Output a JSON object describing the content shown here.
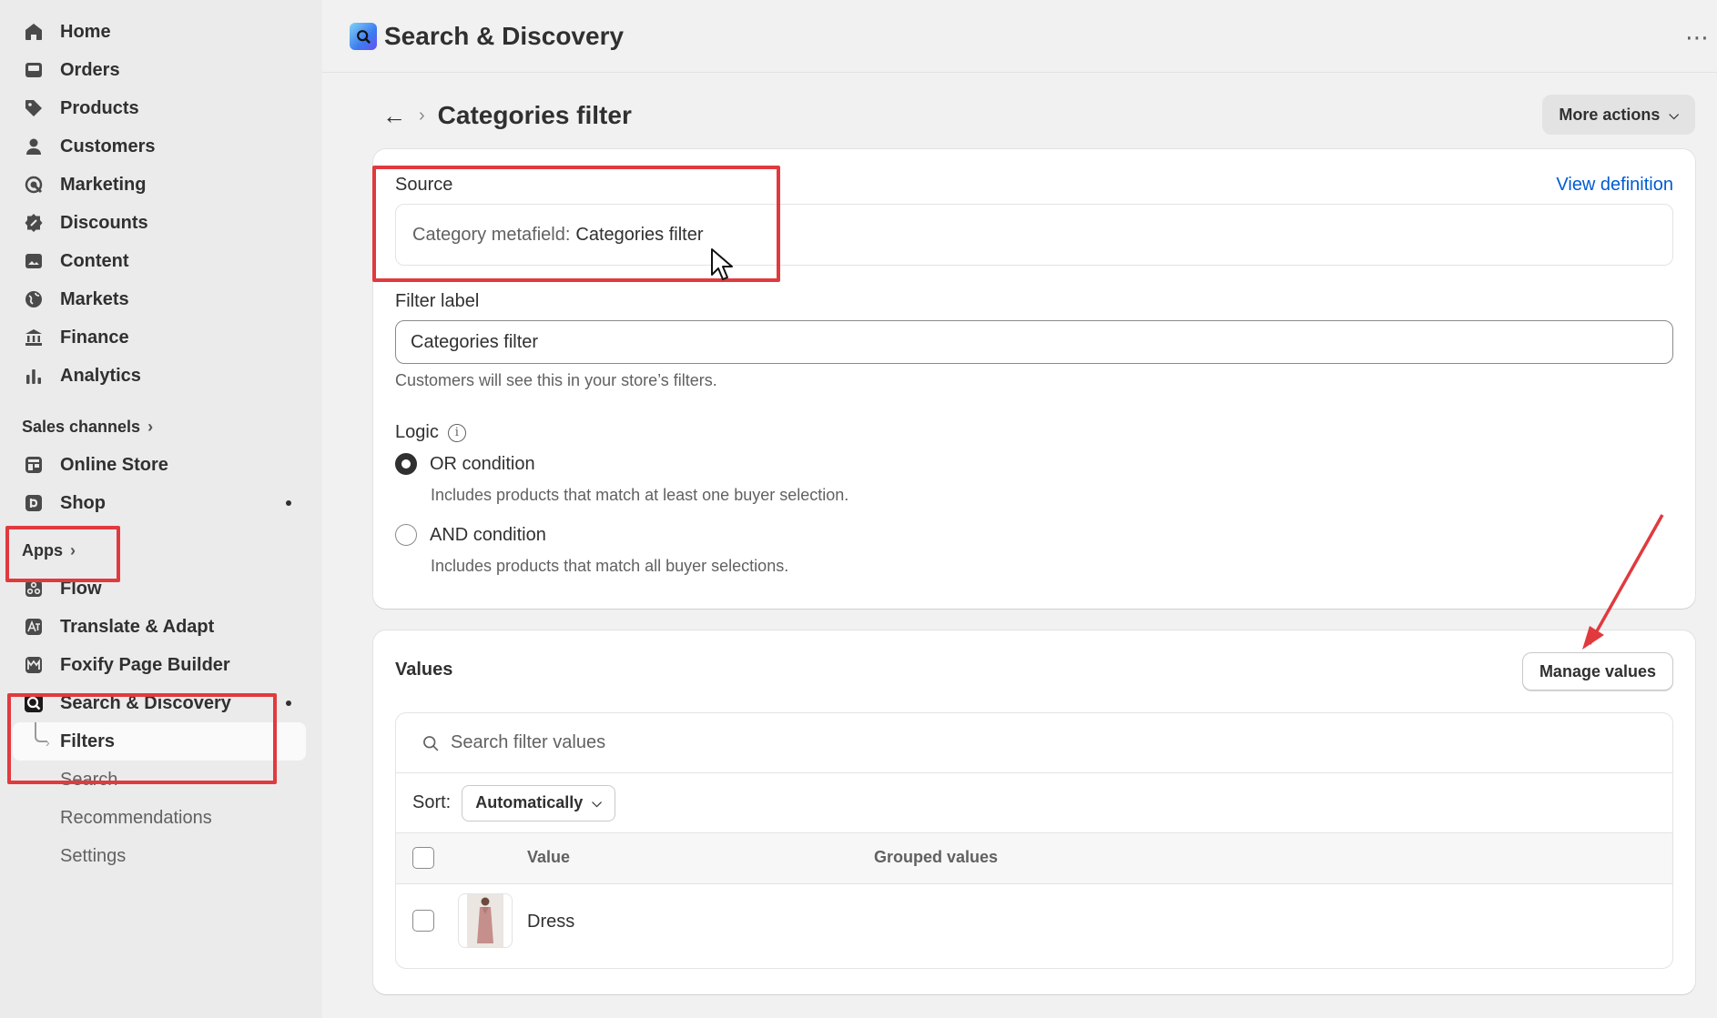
{
  "sidebar": {
    "main_items": [
      {
        "label": "Home",
        "icon": "home-icon"
      },
      {
        "label": "Orders",
        "icon": "inbox-icon"
      },
      {
        "label": "Products",
        "icon": "tag-icon"
      },
      {
        "label": "Customers",
        "icon": "person-icon"
      },
      {
        "label": "Marketing",
        "icon": "target-icon"
      },
      {
        "label": "Discounts",
        "icon": "discount-icon"
      },
      {
        "label": "Content",
        "icon": "image-icon"
      },
      {
        "label": "Markets",
        "icon": "globe-icon"
      },
      {
        "label": "Finance",
        "icon": "bank-icon"
      },
      {
        "label": "Analytics",
        "icon": "bar-chart-icon"
      }
    ],
    "sales_channels_label": "Sales channels",
    "sales_channels": [
      {
        "label": "Online Store",
        "icon": "store-icon"
      },
      {
        "label": "Shop",
        "icon": "shop-icon"
      }
    ],
    "apps_label": "Apps",
    "apps": [
      {
        "label": "Flow",
        "icon": "flow-icon"
      },
      {
        "label": "Translate & Adapt",
        "icon": "translate-icon"
      },
      {
        "label": "Foxify Page Builder",
        "icon": "foxify-icon"
      },
      {
        "label": "Search & Discovery",
        "icon": "search-discovery-icon"
      }
    ],
    "sub_items": [
      "Filters",
      "Search",
      "Recommendations",
      "Settings"
    ]
  },
  "topbar": {
    "app_title": "Search & Discovery",
    "more_icon": "ellipsis-icon"
  },
  "page": {
    "title": "Categories filter",
    "more_actions": "More actions"
  },
  "source_card": {
    "source_label": "Source",
    "view_definition": "View definition",
    "source_prefix": "Category metafield:",
    "source_value": "Categories filter",
    "filter_label": "Filter label",
    "filter_value": "Categories filter",
    "filter_help": "Customers will see this in your store’s filters.",
    "logic_label": "Logic",
    "or_label": "OR condition",
    "or_desc": "Includes products that match at least one buyer selection.",
    "and_label": "AND condition",
    "and_desc": "Includes products that match all buyer selections.",
    "selected": "OR"
  },
  "values_card": {
    "title": "Values",
    "manage_button": "Manage values",
    "search_placeholder": "Search filter values",
    "sort_label": "Sort:",
    "sort_value": "Automatically",
    "columns": [
      "Value",
      "Grouped values"
    ],
    "rows": [
      {
        "value": "Dress",
        "grouped": ""
      }
    ]
  },
  "colors": {
    "accent_link": "#005bd3",
    "annotation_red": "#e03a3f"
  }
}
